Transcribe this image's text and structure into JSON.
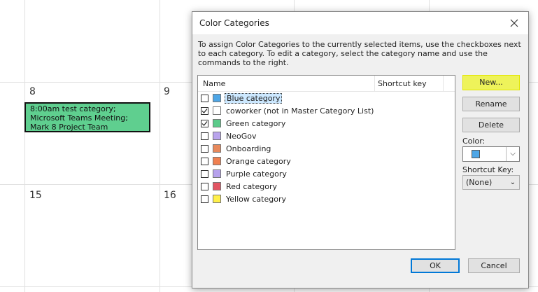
{
  "calendar": {
    "day_numbers": [
      "8",
      "9",
      "15",
      "16"
    ],
    "event_text": "8:00am test category; Microsoft Teams Meeting; Mark 8 Project Team",
    "event_color": "#5fcf8f"
  },
  "dialog": {
    "title": "Color Categories",
    "close_icon": "close-icon",
    "description": "To assign Color Categories to the currently selected items, use the checkboxes next to each category.  To edit a category, select the category name and use the commands to the right.",
    "columns": {
      "name": "Name",
      "shortcut": "Shortcut key"
    },
    "categories": [
      {
        "label": "Blue category",
        "color": "#4ea6e6",
        "checked": false,
        "selected": true
      },
      {
        "label": "coworker (not in Master Category List)",
        "color": "#ffffff",
        "checked": true,
        "selected": false
      },
      {
        "label": "Green category",
        "color": "#5ccb8a",
        "checked": true,
        "selected": false
      },
      {
        "label": "NeoGov",
        "color": "#b9a4ec",
        "checked": false,
        "selected": false
      },
      {
        "label": "Onboarding",
        "color": "#e8895c",
        "checked": false,
        "selected": false
      },
      {
        "label": "Orange category",
        "color": "#f08050",
        "checked": false,
        "selected": false
      },
      {
        "label": "Purple category",
        "color": "#b6a1ec",
        "checked": false,
        "selected": false
      },
      {
        "label": "Red category",
        "color": "#e25563",
        "checked": false,
        "selected": false
      },
      {
        "label": "Yellow category",
        "color": "#fff04a",
        "checked": false,
        "selected": false
      }
    ],
    "buttons": {
      "new": "New...",
      "rename": "Rename",
      "delete": "Delete",
      "ok": "OK",
      "cancel": "Cancel"
    },
    "color_label": "Color:",
    "color_value": "#4ea6e6",
    "shortcut_label": "Shortcut Key:",
    "shortcut_value": "(None)",
    "highlight_color": "#eef35a"
  }
}
